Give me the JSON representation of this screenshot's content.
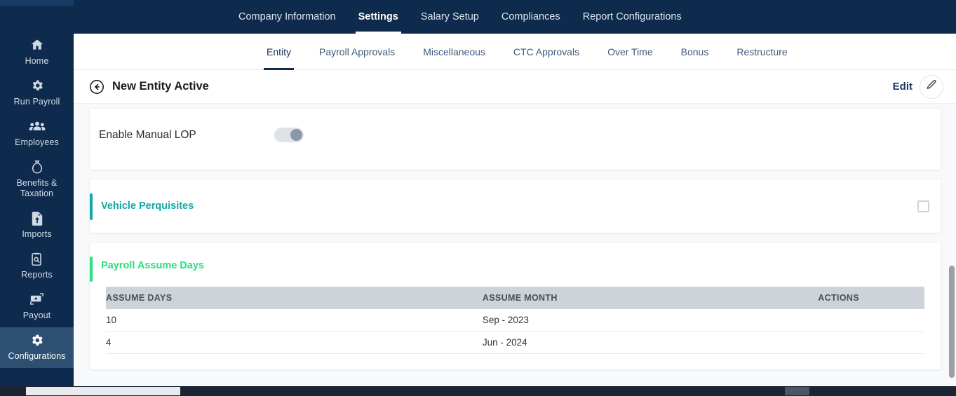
{
  "sidebar": {
    "items": [
      {
        "label": "Home",
        "icon": "home-icon",
        "active": false
      },
      {
        "label": "Run Payroll",
        "icon": "gear-icon",
        "active": false
      },
      {
        "label": "Employees",
        "icon": "people-icon",
        "active": false
      },
      {
        "label": "Benefits & Taxation",
        "icon": "money-bag-icon",
        "active": false
      },
      {
        "label": "Imports",
        "icon": "file-upload-icon",
        "active": false
      },
      {
        "label": "Reports",
        "icon": "report-search-icon",
        "active": false
      },
      {
        "label": "Payout",
        "icon": "money-exchange-icon",
        "active": false
      },
      {
        "label": "Configurations",
        "icon": "gear-icon",
        "active": true
      }
    ]
  },
  "topnav": {
    "items": [
      {
        "label": "Company Information",
        "active": false
      },
      {
        "label": "Settings",
        "active": true
      },
      {
        "label": "Salary Setup",
        "active": false
      },
      {
        "label": "Compliances",
        "active": false
      },
      {
        "label": "Report Configurations",
        "active": false
      }
    ]
  },
  "subtabs": {
    "items": [
      {
        "label": "Entity",
        "active": true
      },
      {
        "label": "Payroll Approvals",
        "active": false
      },
      {
        "label": "Miscellaneous",
        "active": false
      },
      {
        "label": "CTC Approvals",
        "active": false
      },
      {
        "label": "Over Time",
        "active": false
      },
      {
        "label": "Bonus",
        "active": false
      },
      {
        "label": "Restructure",
        "active": false
      }
    ]
  },
  "page_header": {
    "title": "New Entity Active",
    "back_icon": "back-arrow-circle-icon",
    "edit_label": "Edit",
    "edit_icon": "pencil-icon"
  },
  "manual_lop": {
    "label": "Enable Manual LOP",
    "toggle_state": "off"
  },
  "vehicle_perquisites": {
    "title": "Vehicle Perquisites",
    "accent_color": "#10a9a5",
    "checkbox_state": "unchecked"
  },
  "payroll_assume_days": {
    "title": "Payroll Assume Days",
    "accent_color": "#2ae07f",
    "table": {
      "columns": [
        "ASSUME DAYS",
        "ASSUME MONTH",
        "ACTIONS"
      ],
      "rows": [
        {
          "assume_days": "10",
          "assume_month": "Sep - 2023",
          "actions": ""
        },
        {
          "assume_days": "4",
          "assume_month": "Jun - 2024",
          "actions": ""
        }
      ]
    }
  },
  "colors": {
    "sidebar_bg": "#0e2a4d",
    "sidebar_active": "#2d4f72",
    "topnav_bg": "#0e2a4d",
    "page_bg": "#f7f9fb",
    "days_value": "#e03a3a",
    "table_header_bg": "#ced3d9"
  }
}
